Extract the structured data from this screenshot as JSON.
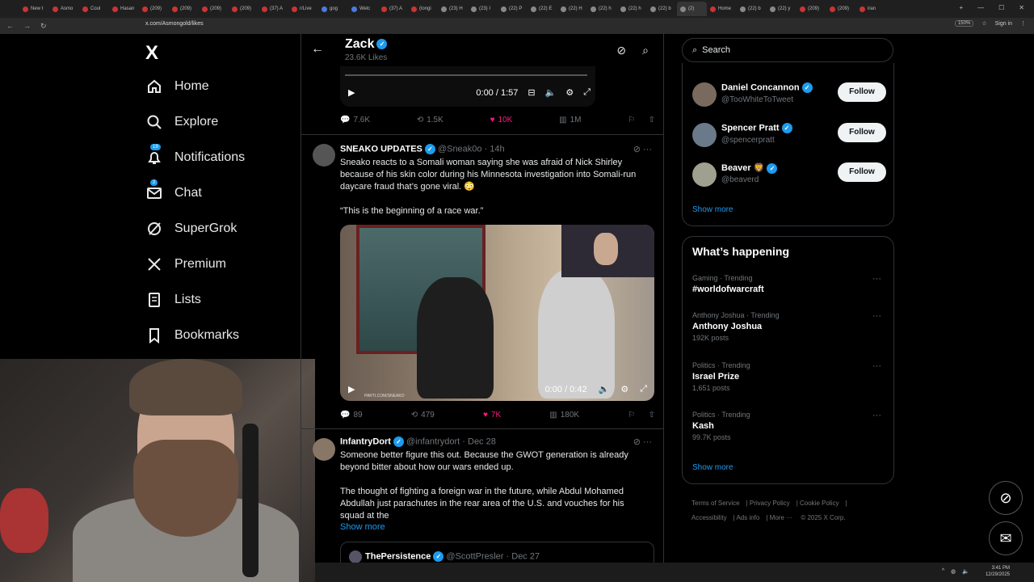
{
  "browser": {
    "tabs": [
      "New t",
      "Asmo",
      "Coul",
      "Hasan",
      "(209)",
      "(209)",
      "(209)",
      "(209)",
      "(37) A",
      "r/Live",
      "gog",
      "Welc",
      "(37) A",
      "(longi",
      "(23) H",
      "(23) I",
      "(22) P",
      "(22) E",
      "(22) H",
      "(22) h",
      "(22) h",
      "(22) b",
      "(2)",
      "Home",
      "(22) b",
      "(22) y",
      "(209)",
      "(209)",
      "iran"
    ],
    "active_tab": "(2)",
    "url": "x.com/Asmongold/likes",
    "zoom": "150%",
    "sign_in": "Sign in"
  },
  "sidebar": {
    "logo": "X",
    "items": [
      {
        "label": "Home",
        "icon": "home-icon"
      },
      {
        "label": "Explore",
        "icon": "search-icon"
      },
      {
        "label": "Notifications",
        "icon": "bell-icon",
        "badge": "19"
      },
      {
        "label": "Chat",
        "icon": "mail-icon",
        "badge": "2"
      },
      {
        "label": "SuperGrok",
        "icon": "grok-icon"
      },
      {
        "label": "Premium",
        "icon": "x-icon"
      },
      {
        "label": "Lists",
        "icon": "list-icon"
      },
      {
        "label": "Bookmarks",
        "icon": "bookmark-icon"
      }
    ]
  },
  "header": {
    "title": "Zack",
    "subtitle": "23.6K Likes"
  },
  "top_video": {
    "time": "0:00 / 1:57"
  },
  "top_actions": {
    "replies": "7.6K",
    "reposts": "1.5K",
    "likes": "10K",
    "views": "1M"
  },
  "tweet1": {
    "name": "SNEAKO UPDATES",
    "handle": "@Sneak0o",
    "time": "· 14h",
    "text1": "Sneako reacts to a Somali woman saying she was afraid of Nick Shirley because of his skin color during his Minnesota investigation into Somali-run daycare fraud that’s gone viral. 😳",
    "text2": "“This is the beginning of a race war.”",
    "video_time": "0:00 / 0:42",
    "watermark": "PARTI.COM/SNEAKO",
    "replies": "89",
    "reposts": "479",
    "likes": "7K",
    "views": "180K"
  },
  "tweet2": {
    "name": "InfantryDort",
    "handle": "@infantrydort",
    "time": "· Dec 28",
    "text1": "Someone better figure this out. Because the GWOT generation is already beyond bitter about how our wars ended up.",
    "text2": "The thought of fighting a foreign war in the future, while Abdul Mohamed Abdullah just parachutes in the rear area of the U.S. and vouches for his squad at the",
    "show_more": "Show more",
    "quote_name": "ThePersistence",
    "quote_handle": "@ScottPresler",
    "quote_time": "· Dec 27"
  },
  "search": {
    "placeholder": "Search"
  },
  "who_to_follow": {
    "users": [
      {
        "name": "Daniel Concannon",
        "handle": "@TooWhiteToTweet"
      },
      {
        "name": "Spencer Pratt",
        "handle": "@spencerpratt"
      },
      {
        "name": "Beaver 🦁",
        "handle": "@beaverd"
      }
    ],
    "follow_label": "Follow",
    "show_more": "Show more"
  },
  "whats_happening": {
    "title": "What’s happening",
    "trends": [
      {
        "category": "Gaming · Trending",
        "topic": "#worldofwarcraft",
        "count": ""
      },
      {
        "category": "Anthony Joshua · Trending",
        "topic": "Anthony Joshua",
        "count": "192K posts"
      },
      {
        "category": "Politics · Trending",
        "topic": "Israel Prize",
        "count": "1,651 posts"
      },
      {
        "category": "Politics · Trending",
        "topic": "Kash",
        "count": "99.7K posts"
      }
    ],
    "show_more": "Show more"
  },
  "footer": {
    "links": [
      "Terms of Service",
      "Privacy Policy",
      "Cookie Policy",
      "Accessibility",
      "Ads info",
      "More ···",
      "© 2025 X Corp."
    ]
  },
  "taskbar": {
    "time": "3:41 PM",
    "date": "12/29/2025"
  }
}
